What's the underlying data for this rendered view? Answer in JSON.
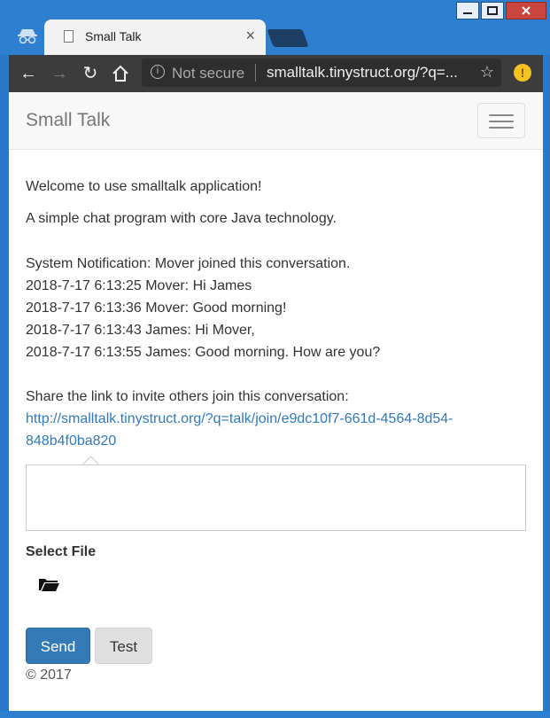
{
  "browser": {
    "tab_title": "Small Talk",
    "tab_close": "×",
    "security_label": "Not secure",
    "url": "smalltalk.tinystruct.org/?q=...",
    "alert_badge": "!"
  },
  "app": {
    "brand": "Small Talk",
    "welcome": "Welcome to use smalltalk application!",
    "subtitle": "A simple chat program with core Java technology.",
    "messages": [
      "System Notification: Mover joined this conversation.",
      "2018-7-17 6:13:25 Mover: Hi James",
      "2018-7-17 6:13:36 Mover: Good morning!",
      "2018-7-17 6:13:43 James: Hi Mover,",
      "2018-7-17 6:13:55 James: Good morning. How are you?"
    ],
    "share_text": "Share the link to invite others join this conversation:",
    "share_link_line1": "http://smalltalk.tinystruct.org/?q=talk/join/e9dc10f7-661d-4564-8d54-",
    "share_link_line2": "848b4f0ba820",
    "message_placeholder": "",
    "select_file_label": "Select File",
    "send_label": "Send",
    "test_label": "Test",
    "footer": "© 2017"
  },
  "colors": {
    "link": "#337ab7",
    "primary_button": "#337ab7",
    "window_frame": "#2f7fd0"
  }
}
